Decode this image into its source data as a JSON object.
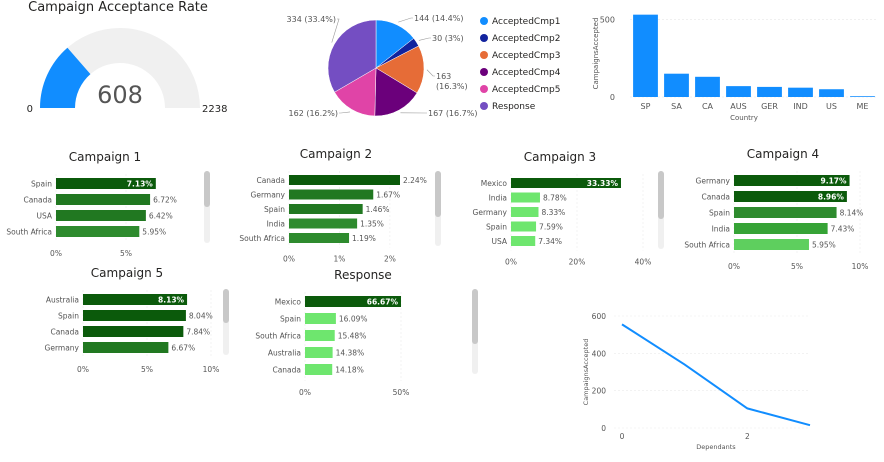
{
  "gauge": {
    "title": "Campaign Acceptance Rate",
    "value": 608,
    "min": 0,
    "max": 2238,
    "value_label": "608",
    "min_label": "0",
    "max_label": "2238",
    "color": "#118dff",
    "track_color": "#f0f0f0"
  },
  "chart_data": [
    {
      "id": "pie",
      "type": "pie",
      "slices": [
        {
          "name": "AcceptedCmp1",
          "value": 144,
          "label": "144 (14.4%)",
          "color": "#118dff"
        },
        {
          "name": "AcceptedCmp2",
          "value": 30,
          "label": "30 (3%)",
          "color": "#12239e"
        },
        {
          "name": "AcceptedCmp3",
          "value": 163,
          "label": "163 (16.3%)",
          "color": "#e66c37"
        },
        {
          "name": "AcceptedCmp4",
          "value": 167,
          "label": "167 (16.7%)",
          "color": "#6b007b"
        },
        {
          "name": "AcceptedCmp5",
          "value": 162,
          "label": "162 (16.2%)",
          "color": "#e044a7"
        },
        {
          "name": "Response",
          "value": 334,
          "label": "334 (33.4%)",
          "color": "#744ec2"
        }
      ]
    },
    {
      "id": "country",
      "type": "bar",
      "categories": [
        "SP",
        "SA",
        "CA",
        "AUS",
        "GER",
        "IND",
        "US",
        "ME"
      ],
      "values": [
        530,
        150,
        130,
        70,
        65,
        60,
        50,
        5
      ],
      "xlabel": "Country",
      "ylabel": "CampaignsAccepted",
      "yticks": [
        "0",
        "500"
      ],
      "ylim": [
        0,
        560
      ],
      "color": "#118dff"
    },
    {
      "id": "cmp1",
      "type": "bar",
      "orientation": "horizontal",
      "title": "Campaign 1",
      "categories": [
        "Spain",
        "Canada",
        "USA",
        "South Africa"
      ],
      "values": [
        7.13,
        6.72,
        6.42,
        5.95
      ],
      "labels": [
        "7.13%",
        "6.72%",
        "6.42%",
        "5.95%"
      ],
      "xticks": [
        "0%",
        "5%"
      ],
      "xlim": [
        0,
        10
      ],
      "colors": [
        "#0b5a0b",
        "#217821",
        "#217821",
        "#2e8b2e"
      ]
    },
    {
      "id": "cmp2",
      "type": "bar",
      "orientation": "horizontal",
      "title": "Campaign 2",
      "categories": [
        "Canada",
        "Germany",
        "Spain",
        "India",
        "South Africa"
      ],
      "values": [
        2.24,
        1.67,
        1.46,
        1.35,
        1.19
      ],
      "labels": [
        "2.24%",
        "1.67%",
        "1.46%",
        "1.35%",
        "1.19%"
      ],
      "xticks": [
        "0%",
        "1%",
        "2%"
      ],
      "xlim": [
        0,
        2.2
      ],
      "colors": [
        "#0b5a0b",
        "#217821",
        "#217821",
        "#2e8b2e",
        "#2e8b2e"
      ]
    },
    {
      "id": "cmp3",
      "type": "bar",
      "orientation": "horizontal",
      "title": "Campaign 3",
      "categories": [
        "Mexico",
        "India",
        "Germany",
        "Spain",
        "USA"
      ],
      "values": [
        33.33,
        8.78,
        8.33,
        7.59,
        7.34
      ],
      "labels": [
        "33.33%",
        "8.78%",
        "8.33%",
        "7.59%",
        "7.34%"
      ],
      "xticks": [
        "0%",
        "20%",
        "40%"
      ],
      "xlim": [
        0,
        40
      ],
      "colors": [
        "#0b5a0b",
        "#6ee66e",
        "#6ee66e",
        "#6ee66e",
        "#6ee66e"
      ]
    },
    {
      "id": "cmp4",
      "type": "bar",
      "orientation": "horizontal",
      "title": "Campaign 4",
      "categories": [
        "Germany",
        "Canada",
        "Spain",
        "India",
        "South Africa"
      ],
      "values": [
        9.17,
        8.96,
        8.14,
        7.43,
        5.95
      ],
      "labels": [
        "9.17%",
        "8.96%",
        "8.14%",
        "7.43%",
        "5.95%"
      ],
      "xticks": [
        "0%",
        "5%",
        "10%"
      ],
      "xlim": [
        0,
        10
      ],
      "colors": [
        "#0b5a0b",
        "#0b5a0b",
        "#2e8b2e",
        "#36a336",
        "#5ecf5e"
      ]
    },
    {
      "id": "cmp5",
      "type": "bar",
      "orientation": "horizontal",
      "title": "Campaign 5",
      "categories": [
        "Australia",
        "Spain",
        "Canada",
        "Germany"
      ],
      "values": [
        8.13,
        8.04,
        7.84,
        6.67
      ],
      "labels": [
        "8.13%",
        "8.04%",
        "7.84%",
        "6.67%"
      ],
      "xticks": [
        "0%",
        "5%",
        "10%"
      ],
      "xlim": [
        0,
        10
      ],
      "colors": [
        "#0b5a0b",
        "#0b5a0b",
        "#0b5a0b",
        "#217821"
      ]
    },
    {
      "id": "response",
      "type": "bar",
      "orientation": "horizontal",
      "title": "Response",
      "categories": [
        "Mexico",
        "Spain",
        "South Africa",
        "Australia",
        "Canada"
      ],
      "values": [
        66.67,
        16.09,
        15.48,
        14.38,
        14.18
      ],
      "labels": [
        "66.67%",
        "16.09%",
        "15.48%",
        "14.38%",
        "14.18%"
      ],
      "xticks": [
        "0%",
        "50%"
      ],
      "xlim": [
        0,
        50
      ],
      "colors": [
        "#0b5a0b",
        "#6ee66e",
        "#6ee66e",
        "#6ee66e",
        "#6ee66e"
      ]
    },
    {
      "id": "dependants",
      "type": "line",
      "x": [
        0,
        1,
        2,
        3
      ],
      "y": [
        555,
        340,
        105,
        15
      ],
      "xlabel": "Dependants",
      "ylabel": "CampaignsAccepted",
      "xticks": [
        "0",
        "2"
      ],
      "yticks": [
        "0",
        "200",
        "400",
        "600"
      ],
      "xlim": [
        0,
        3
      ],
      "ylim": [
        0,
        600
      ],
      "color": "#118dff"
    }
  ]
}
